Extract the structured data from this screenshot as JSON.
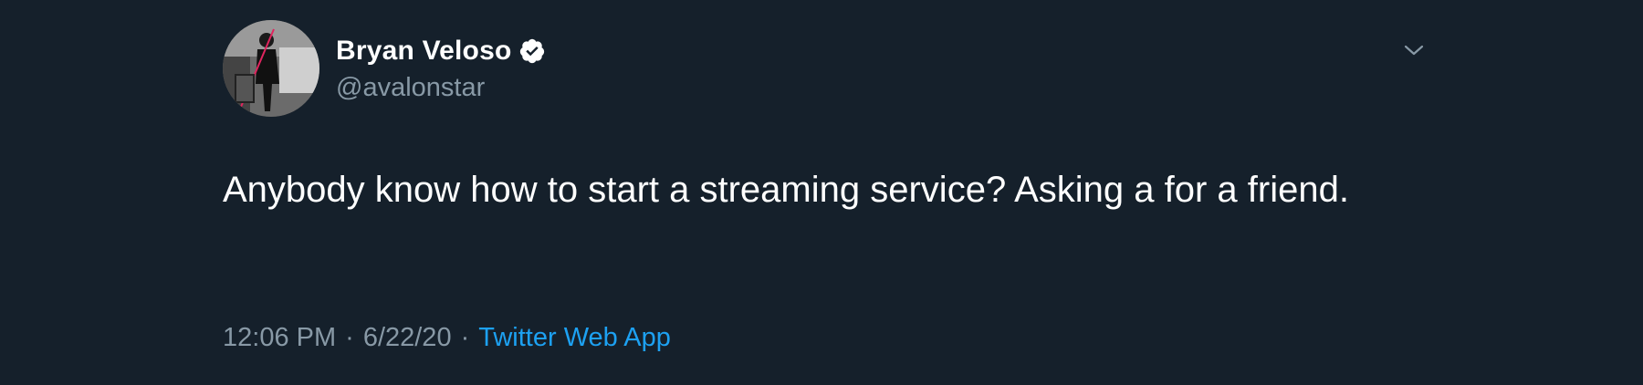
{
  "tweet": {
    "author": {
      "name": "Bryan Veloso",
      "handle": "@avalonstar",
      "verified_icon": "verified-badge-icon"
    },
    "text": "Anybody know how to start a streaming service? Asking a for a friend.",
    "time": "12:06 PM",
    "date": "6/22/20",
    "separator": "·",
    "source": "Twitter Web App",
    "more_icon": "chevron-down-icon"
  },
  "colors": {
    "background": "#15202b",
    "text_primary": "#ffffff",
    "text_secondary": "#8899a6",
    "link": "#1da1f2"
  }
}
